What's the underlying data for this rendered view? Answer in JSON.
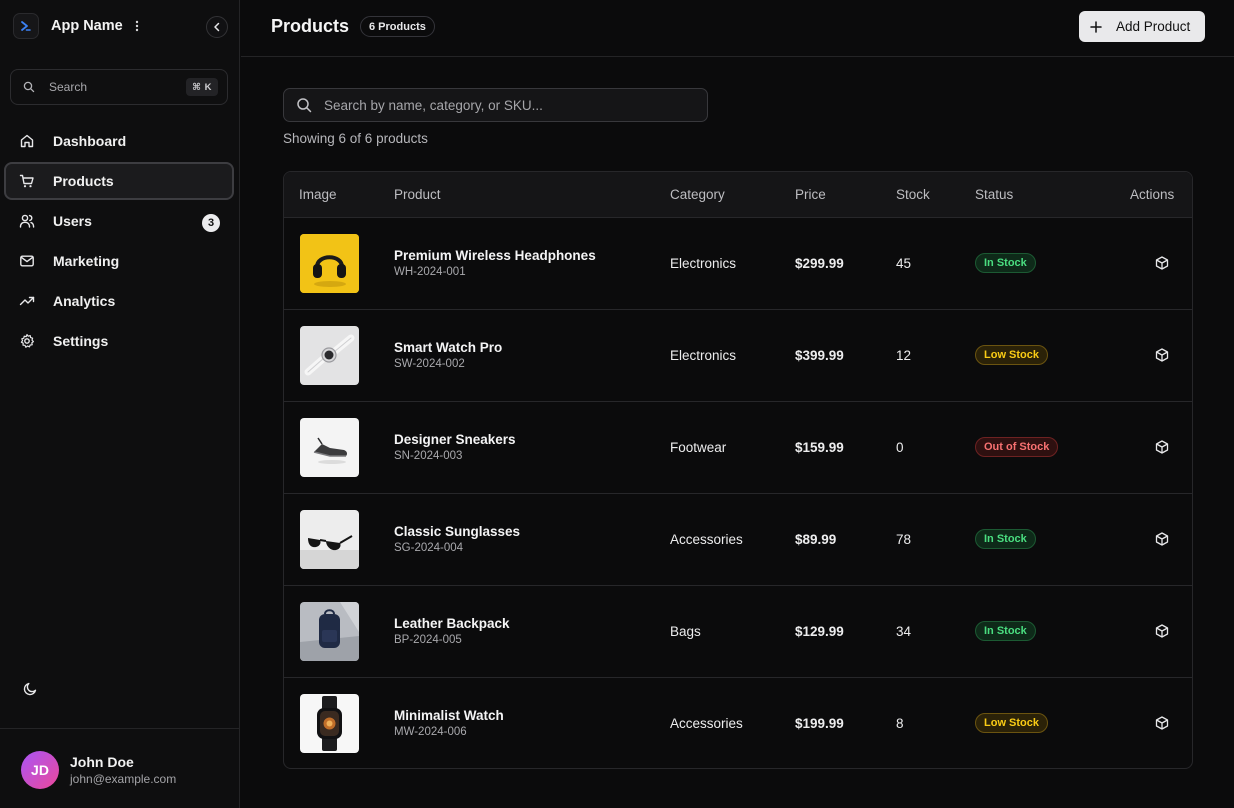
{
  "app": {
    "name": "App Name"
  },
  "sidebar": {
    "search_placeholder": "Search",
    "search_shortcut": "⌘ K",
    "items": [
      {
        "label": "Dashboard",
        "icon": "home-icon"
      },
      {
        "label": "Products",
        "icon": "cart-icon",
        "active": true
      },
      {
        "label": "Users",
        "icon": "users-icon",
        "badge": "3"
      },
      {
        "label": "Marketing",
        "icon": "mail-icon"
      },
      {
        "label": "Analytics",
        "icon": "trending-up-icon"
      },
      {
        "label": "Settings",
        "icon": "gear-icon"
      }
    ]
  },
  "user": {
    "initials": "JD",
    "name": "John Doe",
    "email": "john@example.com"
  },
  "header": {
    "title": "Products",
    "count_badge": "6 Products",
    "add_label": "Add Product"
  },
  "main": {
    "search_placeholder": "Search by name, category, or SKU...",
    "showing": "Showing 6 of 6 products"
  },
  "table": {
    "columns": [
      "Image",
      "Product",
      "Category",
      "Price",
      "Stock",
      "Status",
      "Actions"
    ],
    "rows": [
      {
        "name": "Premium Wireless Headphones",
        "sku": "WH-2024-001",
        "category": "Electronics",
        "price": "$299.99",
        "stock": "45",
        "status": "In Stock",
        "status_kind": "in",
        "image": "headphones"
      },
      {
        "name": "Smart Watch Pro",
        "sku": "SW-2024-002",
        "category": "Electronics",
        "price": "$399.99",
        "stock": "12",
        "status": "Low Stock",
        "status_kind": "low",
        "image": "smartwatch"
      },
      {
        "name": "Designer Sneakers",
        "sku": "SN-2024-003",
        "category": "Footwear",
        "price": "$159.99",
        "stock": "0",
        "status": "Out of Stock",
        "status_kind": "out",
        "image": "sneaker"
      },
      {
        "name": "Classic Sunglasses",
        "sku": "SG-2024-004",
        "category": "Accessories",
        "price": "$89.99",
        "stock": "78",
        "status": "In Stock",
        "status_kind": "in",
        "image": "sunglasses"
      },
      {
        "name": "Leather Backpack",
        "sku": "BP-2024-005",
        "category": "Bags",
        "price": "$129.99",
        "stock": "34",
        "status": "In Stock",
        "status_kind": "in",
        "image": "backpack"
      },
      {
        "name": "Minimalist Watch",
        "sku": "MW-2024-006",
        "category": "Accessories",
        "price": "$199.99",
        "stock": "8",
        "status": "Low Stock",
        "status_kind": "low",
        "image": "watch"
      }
    ]
  },
  "colors": {
    "in_stock": "#4ade80",
    "low_stock": "#facc15",
    "out_of_stock": "#f87171",
    "avatar_from": "#a855f7",
    "avatar_to": "#ec4899",
    "logo_accent": "#3b82f6"
  }
}
